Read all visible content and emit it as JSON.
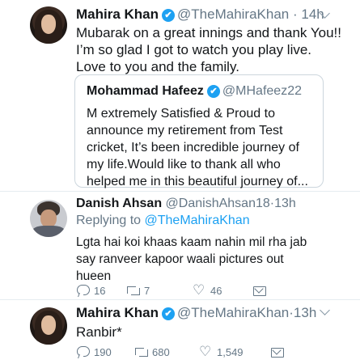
{
  "tweet1": {
    "name": "Mahira Khan",
    "verified_mark": "✔",
    "handle": "@TheMahiraKhan",
    "separator": "·",
    "time": "14h",
    "lines": [
      "Mubarak on a great innings and thank You!!",
      "I’m so glad I got to watch you play live.",
      "Love to you and the family."
    ],
    "quote": {
      "name": "Mohammad Hafeez",
      "verified_mark": "✔",
      "handle": "@MHafeez22",
      "lines": [
        "M extremely Satisfied & Proud to",
        "announce my retirement from Test",
        "cricket, It’s been incredible journey of",
        "my life.Would like to thank all who",
        "helped me in this beautiful journey of..."
      ]
    }
  },
  "tweet2": {
    "name": "Danish Ahsan",
    "handle": "@DanishAhsan18",
    "separator": "·",
    "time": "13h",
    "replying_prefix": "Replying to",
    "replying_handle": "@TheMahiraKhan",
    "lines": [
      "Lgta hai koi khaas kaam nahin mil rha jab",
      "say ranveer kapoor waali pictures out",
      "hueen"
    ],
    "actions": {
      "replies": "16",
      "retweets": "7",
      "likes": "46"
    }
  },
  "tweet3": {
    "name": "Mahira Khan",
    "verified_mark": "✔",
    "handle": "@TheMahiraKhan",
    "separator": "·",
    "time": "13h",
    "text": "Ranbir*",
    "actions": {
      "replies": "190",
      "retweets": "680",
      "likes": "1,549"
    }
  },
  "icons": [
    "caret-down-icon",
    "verified-icon",
    "reply-icon",
    "retweet-icon",
    "heart-icon",
    "direct-message-icon"
  ],
  "colors": {
    "accent": "#1da1f2",
    "muted": "#657786",
    "text": "#14171a",
    "border": "#ccd6dd"
  }
}
